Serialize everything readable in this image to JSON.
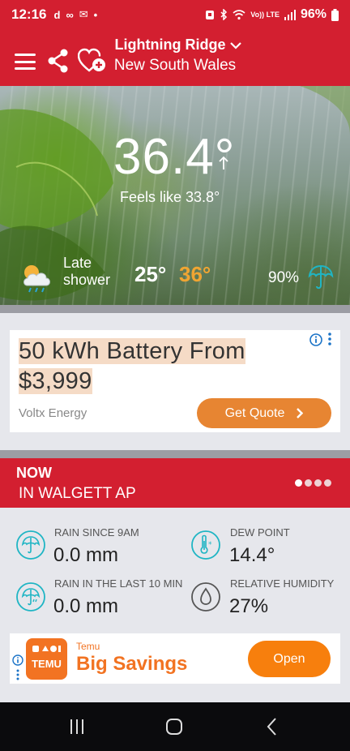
{
  "status_bar": {
    "time": "12:16",
    "notification_icons": [
      "d",
      "∞",
      "✉",
      "•"
    ],
    "network": "Vo)) LTE",
    "battery_pct": "96%"
  },
  "header": {
    "location_name": "Lightning Ridge",
    "location_state": "New South Wales",
    "icons": {
      "menu": "menu-icon",
      "share": "share-icon",
      "favourite": "heart-plus-icon",
      "dropdown": "chevron-down-icon"
    }
  },
  "current": {
    "temperature": "36.4°",
    "trend": "rising",
    "feels_like": "Feels like 33.8°",
    "description": "Late shower",
    "min_temp": "25°",
    "max_temp": "36°",
    "rain_chance": "90%"
  },
  "ad_battery": {
    "title": "50 kWh Battery From $3,999",
    "advertiser": "Voltx Energy",
    "cta": "Get Quote",
    "cta_color": "#e78532"
  },
  "now": {
    "title": "NOW",
    "station": "IN WALGETT AP",
    "page_count": 4,
    "active_page": 1,
    "observations": {
      "rain_since_9am": {
        "label": "RAIN SINCE 9AM",
        "value": "0.0 mm",
        "icon": "umbrella-icon"
      },
      "dew_point": {
        "label": "DEW POINT",
        "value": "14.4°",
        "icon": "thermometer-icon"
      },
      "rain_last_10": {
        "label": "RAIN IN THE LAST 10 MIN",
        "value": "0.0 mm",
        "icon": "umbrella-rain-icon"
      },
      "humidity": {
        "label": "RELATIVE HUMIDITY",
        "value": "27%",
        "icon": "droplet-icon"
      }
    }
  },
  "ad_temu": {
    "advertiser": "Temu",
    "title": "Big Savings",
    "cta": "Open",
    "logo_text": "TEMU",
    "brand_color": "#f27322"
  },
  "colors": {
    "brand_red": "#d31f30",
    "accent_teal": "#1fb5c4",
    "max_temp_orange": "#f0a532"
  }
}
